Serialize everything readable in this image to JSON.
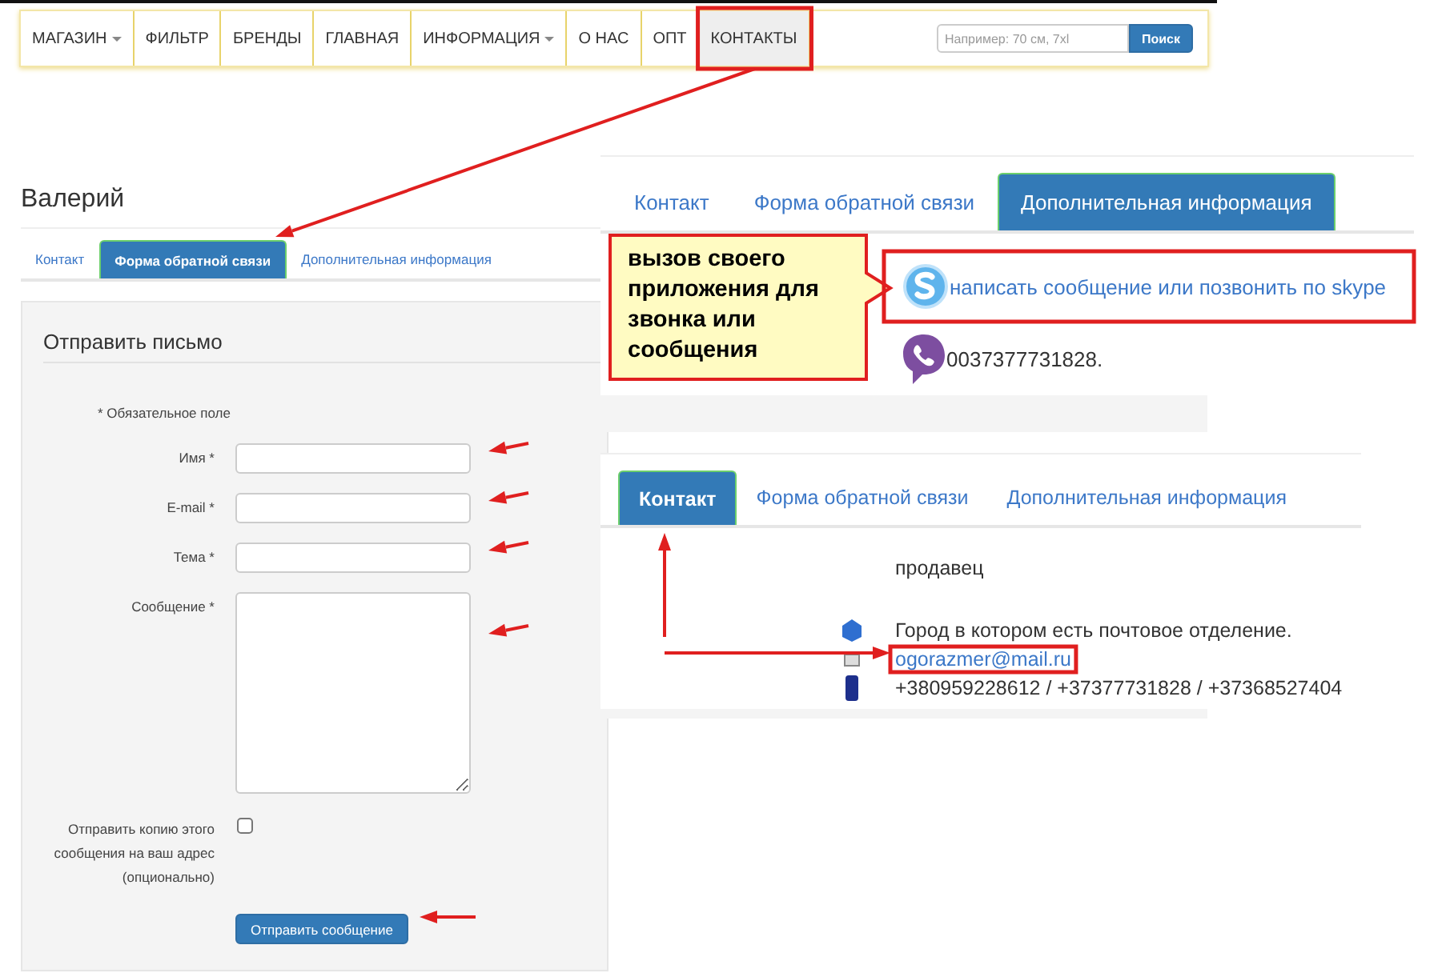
{
  "navbar": {
    "items": [
      {
        "label": "МАГАЗИН",
        "dropdown": true,
        "selected": false
      },
      {
        "label": "ФИЛЬТР",
        "dropdown": false,
        "selected": false
      },
      {
        "label": "БРЕНДЫ",
        "dropdown": false,
        "selected": false
      },
      {
        "label": "ГЛАВНАЯ",
        "dropdown": false,
        "selected": false
      },
      {
        "label": "ИНФОРМАЦИЯ",
        "dropdown": true,
        "selected": false
      },
      {
        "label": "О НАС",
        "dropdown": false,
        "selected": false
      },
      {
        "label": "ОПТ",
        "dropdown": false,
        "selected": false
      },
      {
        "label": "КОНТАКТЫ",
        "dropdown": false,
        "selected": true
      }
    ],
    "search": {
      "placeholder": "Например: 70 см, 7xl"
    },
    "search_button": "Поиск"
  },
  "form_panel": {
    "title": "Валерий",
    "tabs": [
      {
        "label": "Контакт",
        "selected": false
      },
      {
        "label": "Форма обратной связи",
        "selected": true
      },
      {
        "label": "Дополнительная информация",
        "selected": false
      }
    ],
    "legend": "Отправить письмо",
    "required_note": "* Обязательное поле",
    "fields": [
      {
        "label": "Имя *",
        "kind": "input"
      },
      {
        "label": "E-mail *",
        "kind": "input"
      },
      {
        "label": "Тема *",
        "kind": "input"
      },
      {
        "label": "Сообщение *",
        "kind": "textarea"
      }
    ],
    "copy": {
      "label": "Отправить копию этого сообщения на ваш адрес (опционально)",
      "checked": false
    },
    "submit": "Отправить сообщение"
  },
  "info_panel": {
    "tabs": [
      {
        "label": "Контакт",
        "selected": false
      },
      {
        "label": "Форма обратной связи",
        "selected": false
      },
      {
        "label": "Дополнительная информация",
        "selected": true
      }
    ],
    "skype_link": "написать сообщение или позвонить по skype",
    "viber_phone": "0037377731828."
  },
  "callout": {
    "text": "вызов своего приложения для звонка или сообщения"
  },
  "contact_panel": {
    "tabs": [
      {
        "label": "Контакт",
        "selected": true
      },
      {
        "label": "Форма обратной связи",
        "selected": false
      },
      {
        "label": "Дополнительная информация",
        "selected": false
      }
    ],
    "seller": "продавец",
    "address": "Город в котором есть почтовое отделение.",
    "email": "ogorazmer@mail.ru",
    "phones": "+380959228612 / +37377731828 / +37368527404"
  }
}
